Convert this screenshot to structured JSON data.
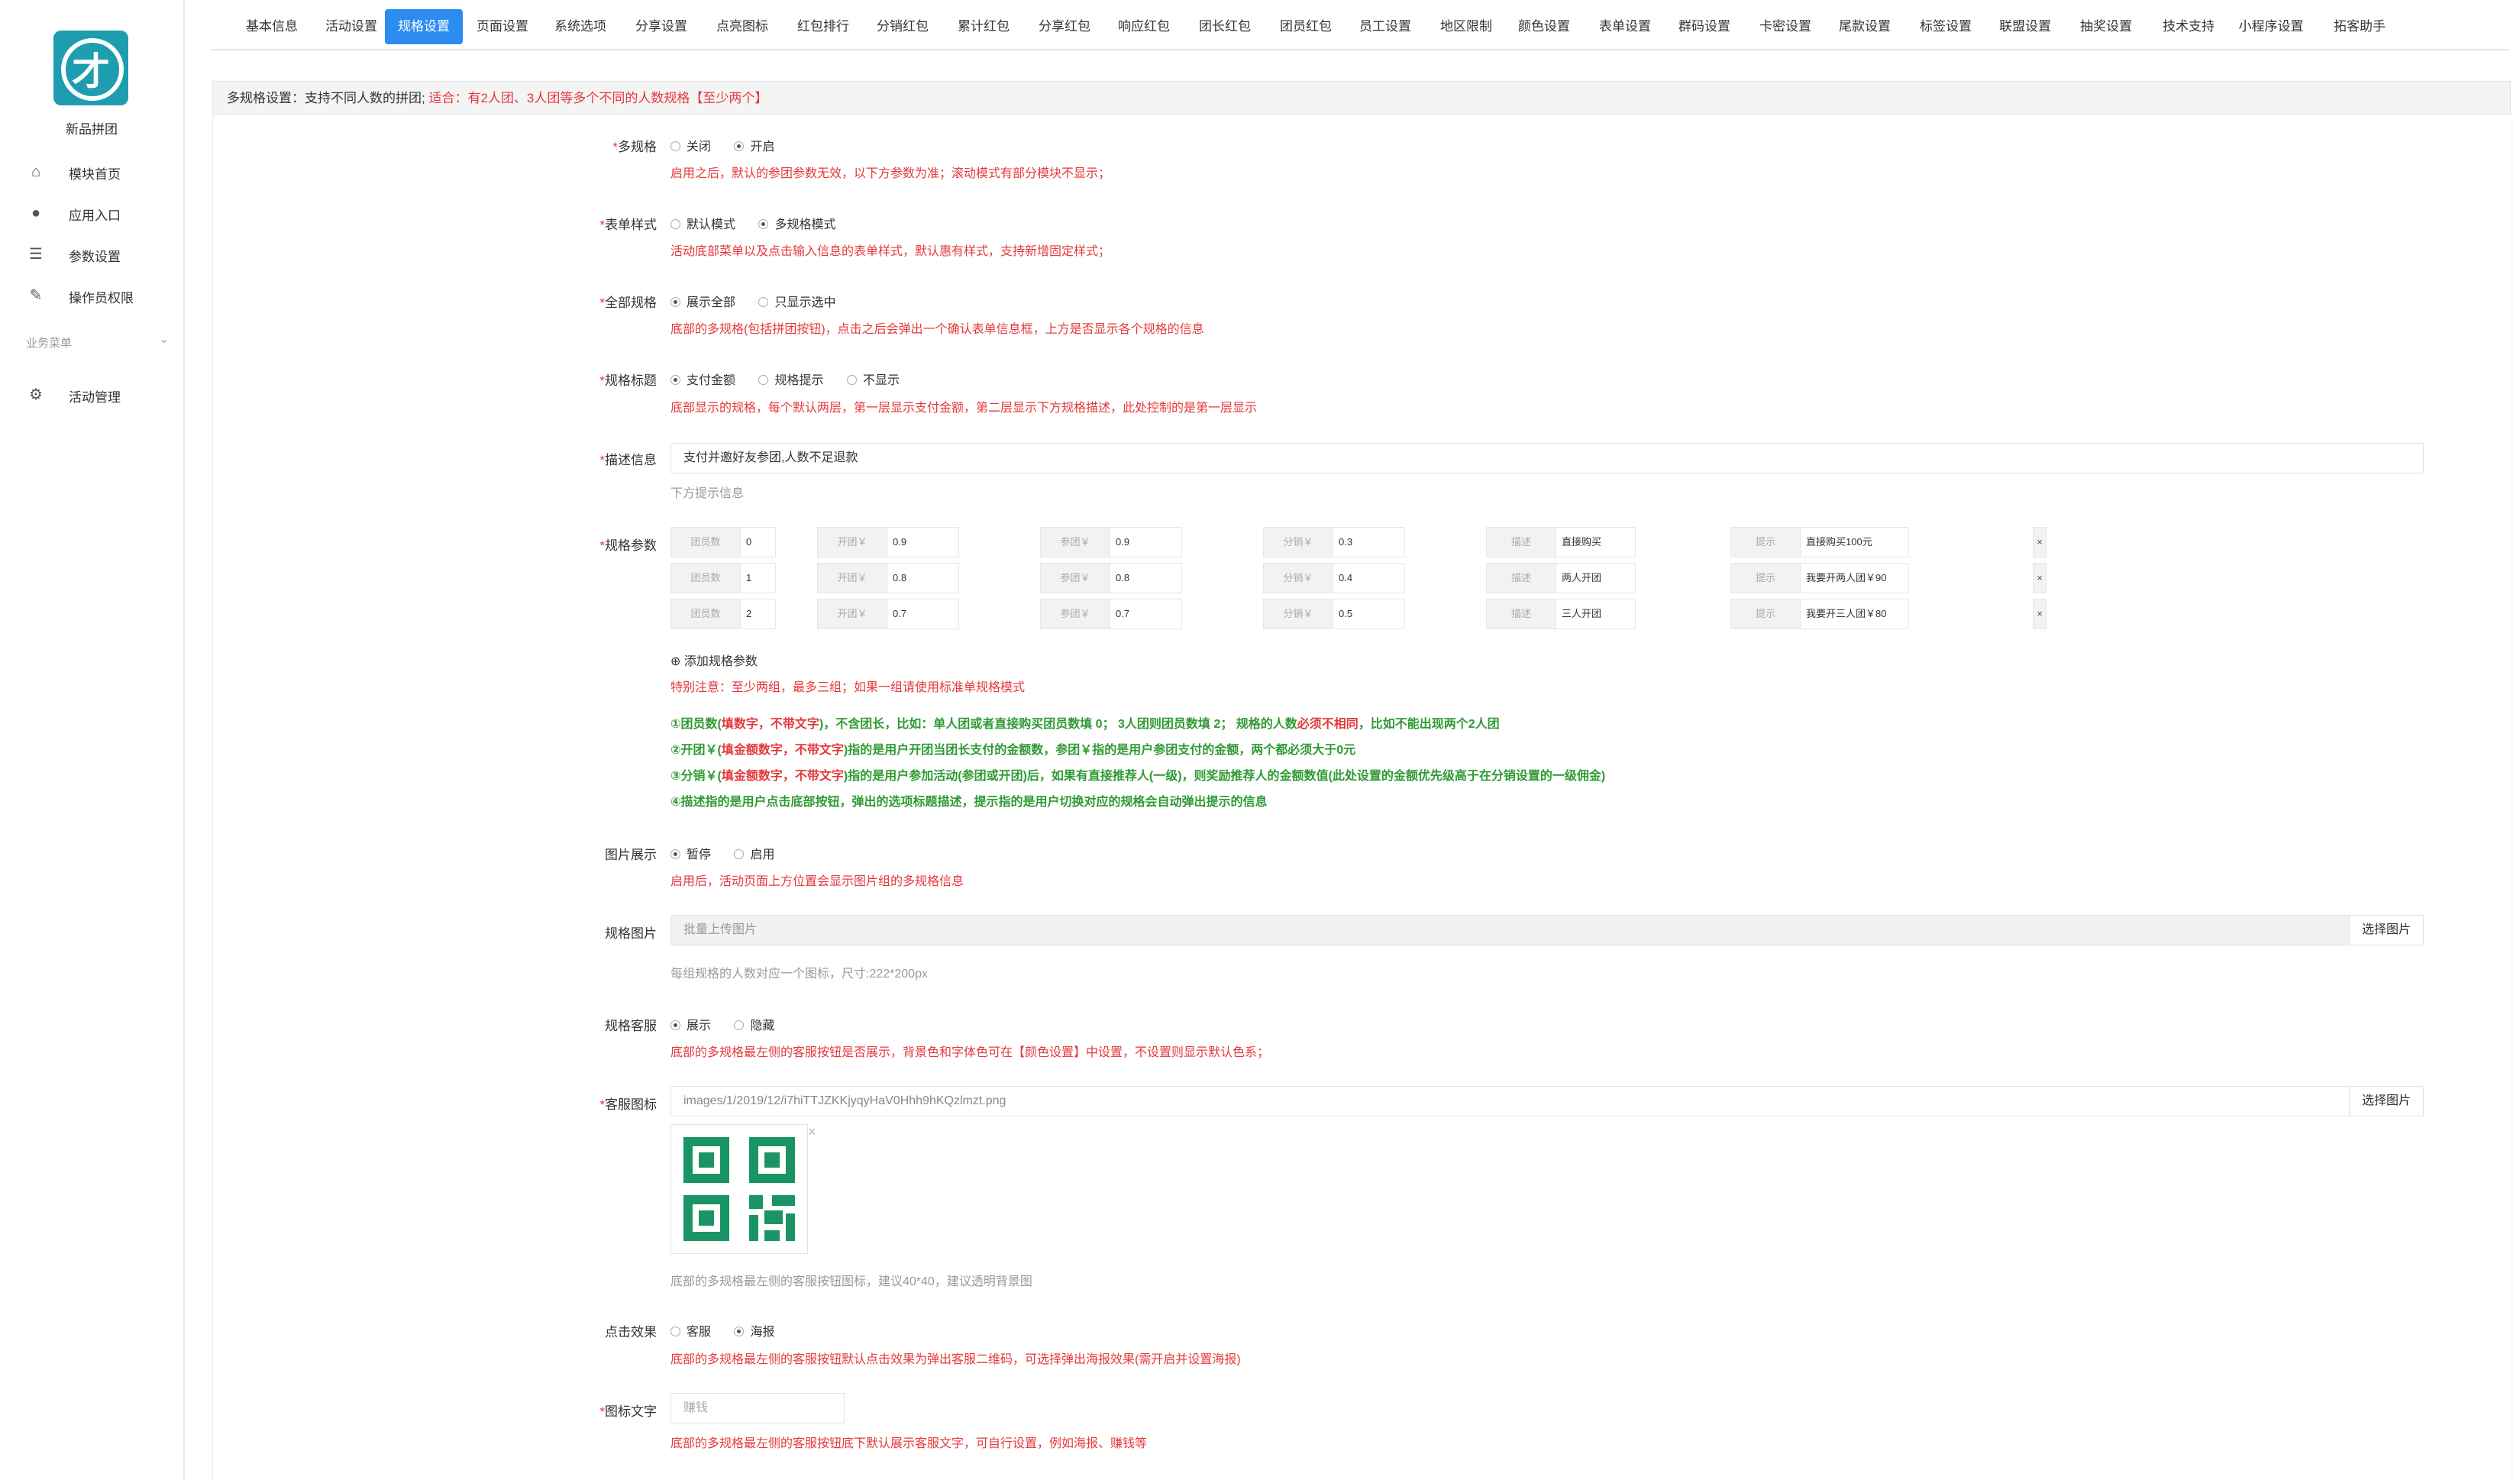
{
  "app": {
    "name": "新品拼团"
  },
  "sidebar": {
    "items": [
      {
        "label": "模块首页"
      },
      {
        "label": "应用入口"
      },
      {
        "label": "参数设置"
      },
      {
        "label": "操作员权限"
      }
    ],
    "group_label": "业务菜单",
    "group_items": [
      {
        "label": "活动管理"
      }
    ]
  },
  "tabs": [
    "基本信息",
    "活动设置",
    "规格设置",
    "页面设置",
    "系统选项",
    "分享设置",
    "点亮图标",
    "红包排行",
    "分销红包",
    "累计红包",
    "分享红包",
    "响应红包",
    "团长红包",
    "团员红包",
    "员工设置",
    "地区限制",
    "颜色设置",
    "表单设置",
    "群码设置",
    "卡密设置",
    "尾款设置",
    "标签设置",
    "联盟设置",
    "抽奖设置",
    "技术支持",
    "小程序设置",
    "拓客助手"
  ],
  "active_tab": "规格设置",
  "notice": {
    "prefix": "多规格设置：支持不同人数的拼团; ",
    "red": "适合：有2人团、3人团等多个不同的人数规格【至少两个】"
  },
  "form": {
    "multi_spec": {
      "label": "多规格",
      "options": [
        "关闭",
        "开启"
      ],
      "selected": "开启",
      "hint": "启用之后，默认的参团参数无效，以下方参数为准；滚动模式有部分模块不显示；"
    },
    "form_style": {
      "label": "表单样式",
      "options": [
        "默认模式",
        "多规格模式"
      ],
      "selected": "多规格模式",
      "hint": "活动底部菜单以及点击输入信息的表单样式，默认惠有样式，支持新增固定样式；"
    },
    "all_spec": {
      "label": "全部规格",
      "options": [
        "展示全部",
        "只显示选中"
      ],
      "selected": "展示全部",
      "hint": "底部的多规格(包括拼团按钮)，点击之后会弹出一个确认表单信息框，上方是否显示各个规格的信息"
    },
    "spec_title": {
      "label": "规格标题",
      "options": [
        "支付金额",
        "规格提示",
        "不显示"
      ],
      "selected": "支付金额",
      "hint": "底部显示的规格，每个默认两层，第一层显示支付金额，第二层显示下方规格描述，此处控制的是第一层显示"
    },
    "desc": {
      "label": "描述信息",
      "value": "支付并邀好友参团,人数不足退款",
      "hint": "下方提示信息"
    },
    "spec_params": {
      "label": "规格参数",
      "prefixes": [
        "团员数",
        "开团￥",
        "参团￥",
        "分销￥",
        "描述",
        "提示"
      ],
      "rows": [
        [
          "0",
          "0.9",
          "0.9",
          "0.3",
          "直接购买",
          "直接购买100元"
        ],
        [
          "1",
          "0.8",
          "0.8",
          "0.4",
          "两人开团",
          "我要开两人团￥90"
        ],
        [
          "2",
          "0.7",
          "0.7",
          "0.5",
          "三人开团",
          "我要开三人团￥80"
        ]
      ],
      "delete_glyph": "×",
      "add_label": "添加规格参数",
      "note": "特别注意：至少两组，最多三组；如果一组请使用标准单规格模式",
      "rule1": {
        "a": "①团员数(",
        "b": "填数字，不带文字",
        "c": ")，不含团长，比如：单人团或者直接购买团员数填 0； 3人团则团员数填 2； 规格的人数",
        "d": "必须不相同",
        "e": "，比如不能出现两个2人团"
      },
      "rule2": {
        "a": "②开团￥(",
        "b": "填金额数字，不带文字",
        "c": ")指的是用户开团当团长支付的金额数，参团￥指的是用户参团支付的金额，两个都必须大于0元"
      },
      "rule3": {
        "a": "③分销￥(",
        "b": "填金额数字，不带文字",
        "c": ")指的是用户参加活动(参团或开团)后，如果有直接推荐人(一级)，则奖励推荐人的金额数值(此处设置的金额优先级高于在分销设置的一级佣金)"
      },
      "rule4": "④描述指的是用户点击底部按钮，弹出的选项标题描述，提示指的是用户切换对应的规格会自动弹出提示的信息"
    },
    "image_show": {
      "label": "图片展示",
      "options": [
        "暂停",
        "启用"
      ],
      "selected": "暂停",
      "hint": "启用后，活动页面上方位置会显示图片组的多规格信息"
    },
    "spec_images": {
      "label": "规格图片",
      "placeholder": "批量上传图片",
      "button": "选择图片",
      "hint": "每组规格的人数对应一个图标，尺寸:222*200px"
    },
    "spec_service": {
      "label": "规格客服",
      "options": [
        "展示",
        "隐藏"
      ],
      "selected": "展示",
      "hint": "底部的多规格最左侧的客服按钮是否展示，背景色和字体色可在【颜色设置】中设置，不设置则显示默认色系；"
    },
    "service_icon": {
      "label": "客服图标",
      "value": "images/1/2019/12/i7hiTTJZKKjyqyHaV0Hhh9hKQzlmzt.png",
      "button": "选择图片",
      "close": "×",
      "hint": "底部的多规格最左侧的客服按钮图标，建议40*40，建议透明背景图",
      "icon_color": "#1a9465"
    },
    "click_effect": {
      "label": "点击效果",
      "options": [
        "客服",
        "海报"
      ],
      "selected": "海报",
      "hint": "底部的多规格最左侧的客服按钮默认点击效果为弹出客服二维码，可选择弹出海报效果(需开启并设置海报)"
    },
    "icon_text": {
      "label": "图标文字",
      "placeholder": "赚钱",
      "hint": "底部的多规格最左侧的客服按钮底下默认展示客服文字，可自行设置，例如海报、赚钱等"
    }
  },
  "colors": {
    "accent": "#2d8cf0",
    "warn": "#e4393c",
    "ok": "#2e9a33"
  }
}
